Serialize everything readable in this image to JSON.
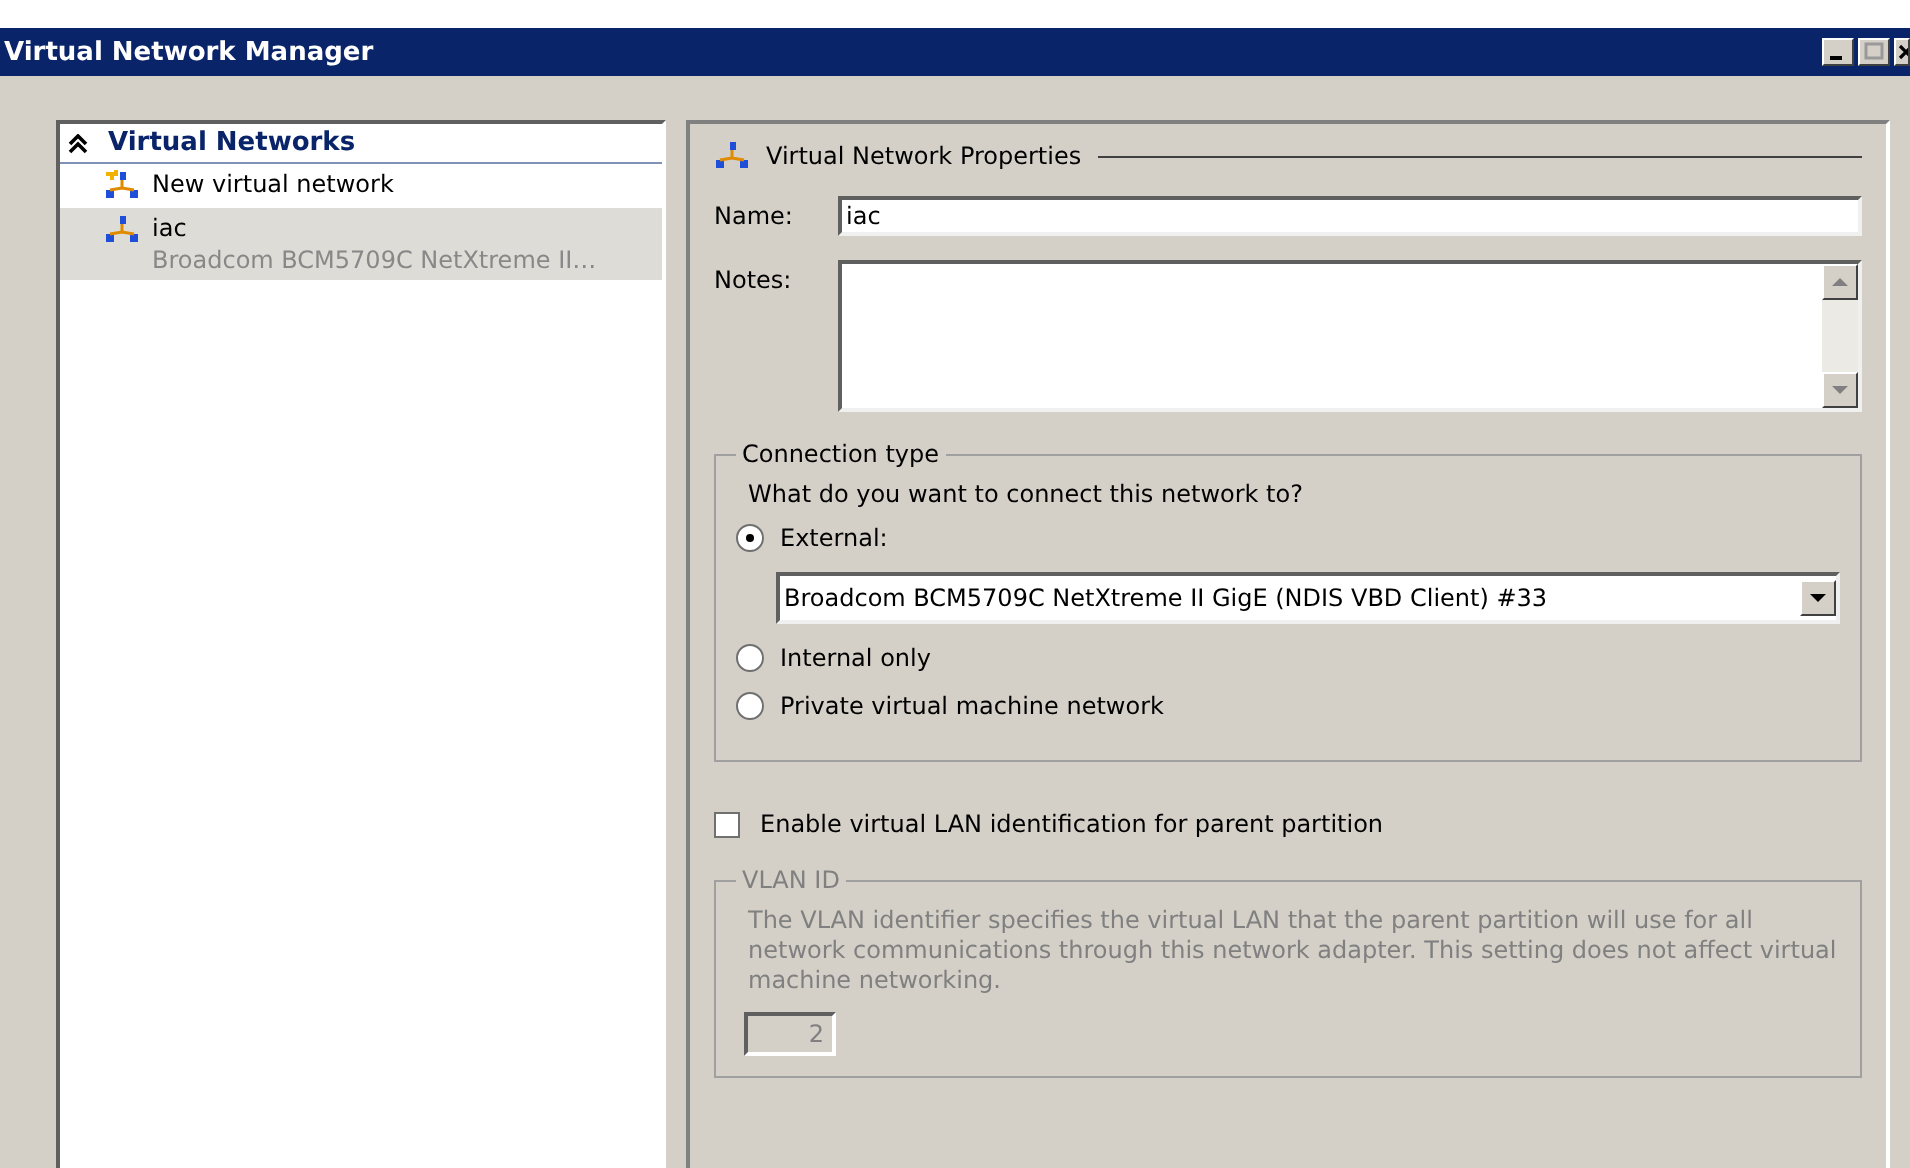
{
  "window": {
    "title": "Virtual Network Manager"
  },
  "sidebar": {
    "heading": "Virtual Networks",
    "expanded": true,
    "items": [
      {
        "kind": "action",
        "label": "New virtual network",
        "selected": false
      },
      {
        "kind": "network",
        "label": "iac",
        "detail": "Broadcom BCM5709C NetXtreme II…",
        "selected": true
      }
    ]
  },
  "properties": {
    "title": "Virtual Network Properties",
    "name_label": "Name:",
    "name_value": "iac",
    "notes_label": "Notes:",
    "connection": {
      "title": "Connection type",
      "prompt": "What do you want to connect this network to?",
      "adapter": "Broadcom BCM5709C NetXtreme II GigE (NDIS VBD Client) #33",
      "options": [
        {
          "label": "External:",
          "selected": true
        },
        {
          "label": "Internal only",
          "selected": false
        },
        {
          "label": "Private virtual machine network",
          "selected": false
        }
      ]
    },
    "vlan_checkbox": {
      "label": "Enable virtual LAN identification for parent partition",
      "checked": false
    },
    "vlan": {
      "title": "VLAN ID",
      "disabled": true,
      "description": "The VLAN identifier specifies the virtual LAN that the parent partition will use for all network communications through this network adapter. This setting does not affect virtual machine networking.",
      "value": "2"
    }
  }
}
